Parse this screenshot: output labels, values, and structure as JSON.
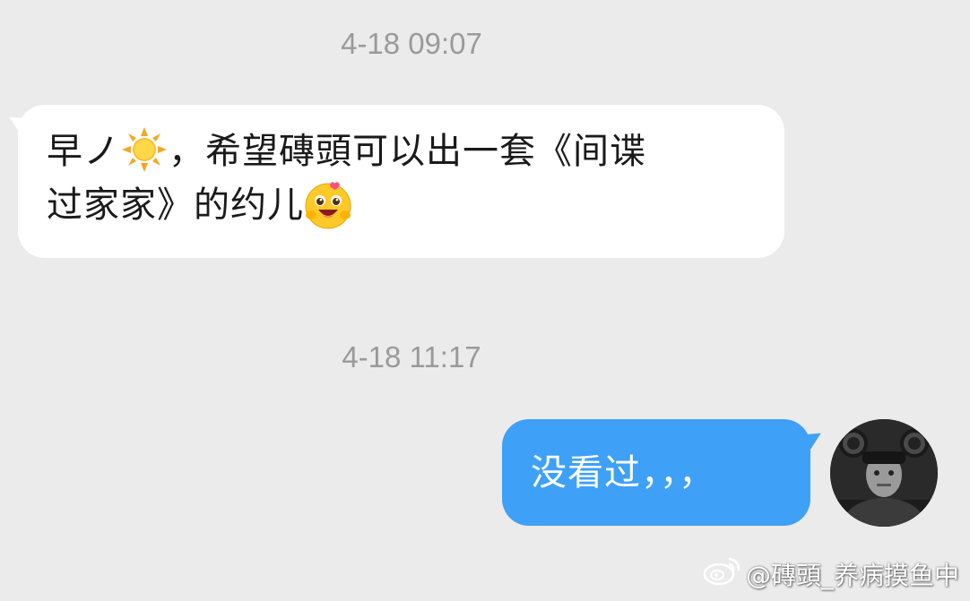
{
  "chat": {
    "timestamp_1": "4-18 09:07",
    "timestamp_2": "4-18 11:17",
    "incoming": {
      "line1_a": "早ノ",
      "line1_b": "，希望磚頭可以出一套《间谍",
      "line2": "过家家》的约儿",
      "emoji_1": "sun-emoji",
      "emoji_2": "blushing-face-emoji"
    },
    "outgoing": {
      "text": "没看过，，，"
    },
    "avatar": "user-avatar"
  },
  "watermark": {
    "text": "@磚頭_养病摸鱼中",
    "icon": "weibo-logo-icon"
  },
  "colors": {
    "background": "#ebebeb",
    "incoming_bubble": "#ffffff",
    "outgoing_bubble": "#3ea0f7",
    "timestamp": "#9a9a9a"
  }
}
